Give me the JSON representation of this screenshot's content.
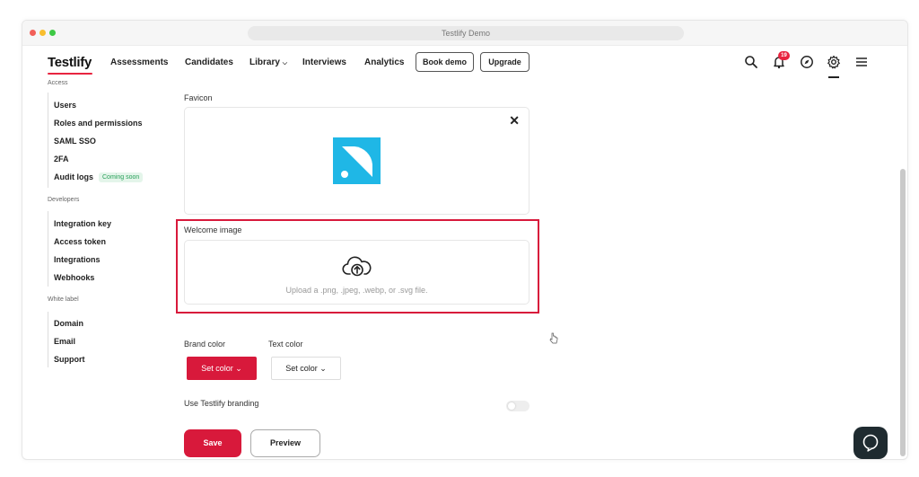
{
  "window": {
    "title": "Testlify Demo"
  },
  "nav": {
    "logo": "Testlify",
    "links": [
      "Assessments",
      "Candidates",
      "Library",
      "Interviews",
      "Analytics"
    ],
    "book_demo": "Book demo",
    "upgrade": "Upgrade",
    "notification_count": "19"
  },
  "sidebar": {
    "access_head": "Access",
    "access_items": [
      "Users",
      "Roles and permissions",
      "SAML SSO",
      "2FA",
      "Audit logs"
    ],
    "coming_soon": "Coming soon",
    "developers_head": "Developers",
    "developers_items": [
      "Integration key",
      "Access token",
      "Integrations",
      "Webhooks"
    ],
    "white_label_head": "White label",
    "white_label_items": [
      "Domain",
      "Email",
      "Support"
    ]
  },
  "main": {
    "favicon_label": "Favicon",
    "welcome_label": "Welcome image",
    "upload_hint": "Upload a .png, .jpeg, .webp, or .svg file.",
    "brand_color_label": "Brand color",
    "text_color_label": "Text color",
    "set_color": "Set color",
    "branding_label": "Use Testlify branding",
    "save": "Save",
    "preview": "Preview"
  },
  "colors": {
    "accent": "#d8193b",
    "favicon_blue": "#1fb7e6"
  }
}
